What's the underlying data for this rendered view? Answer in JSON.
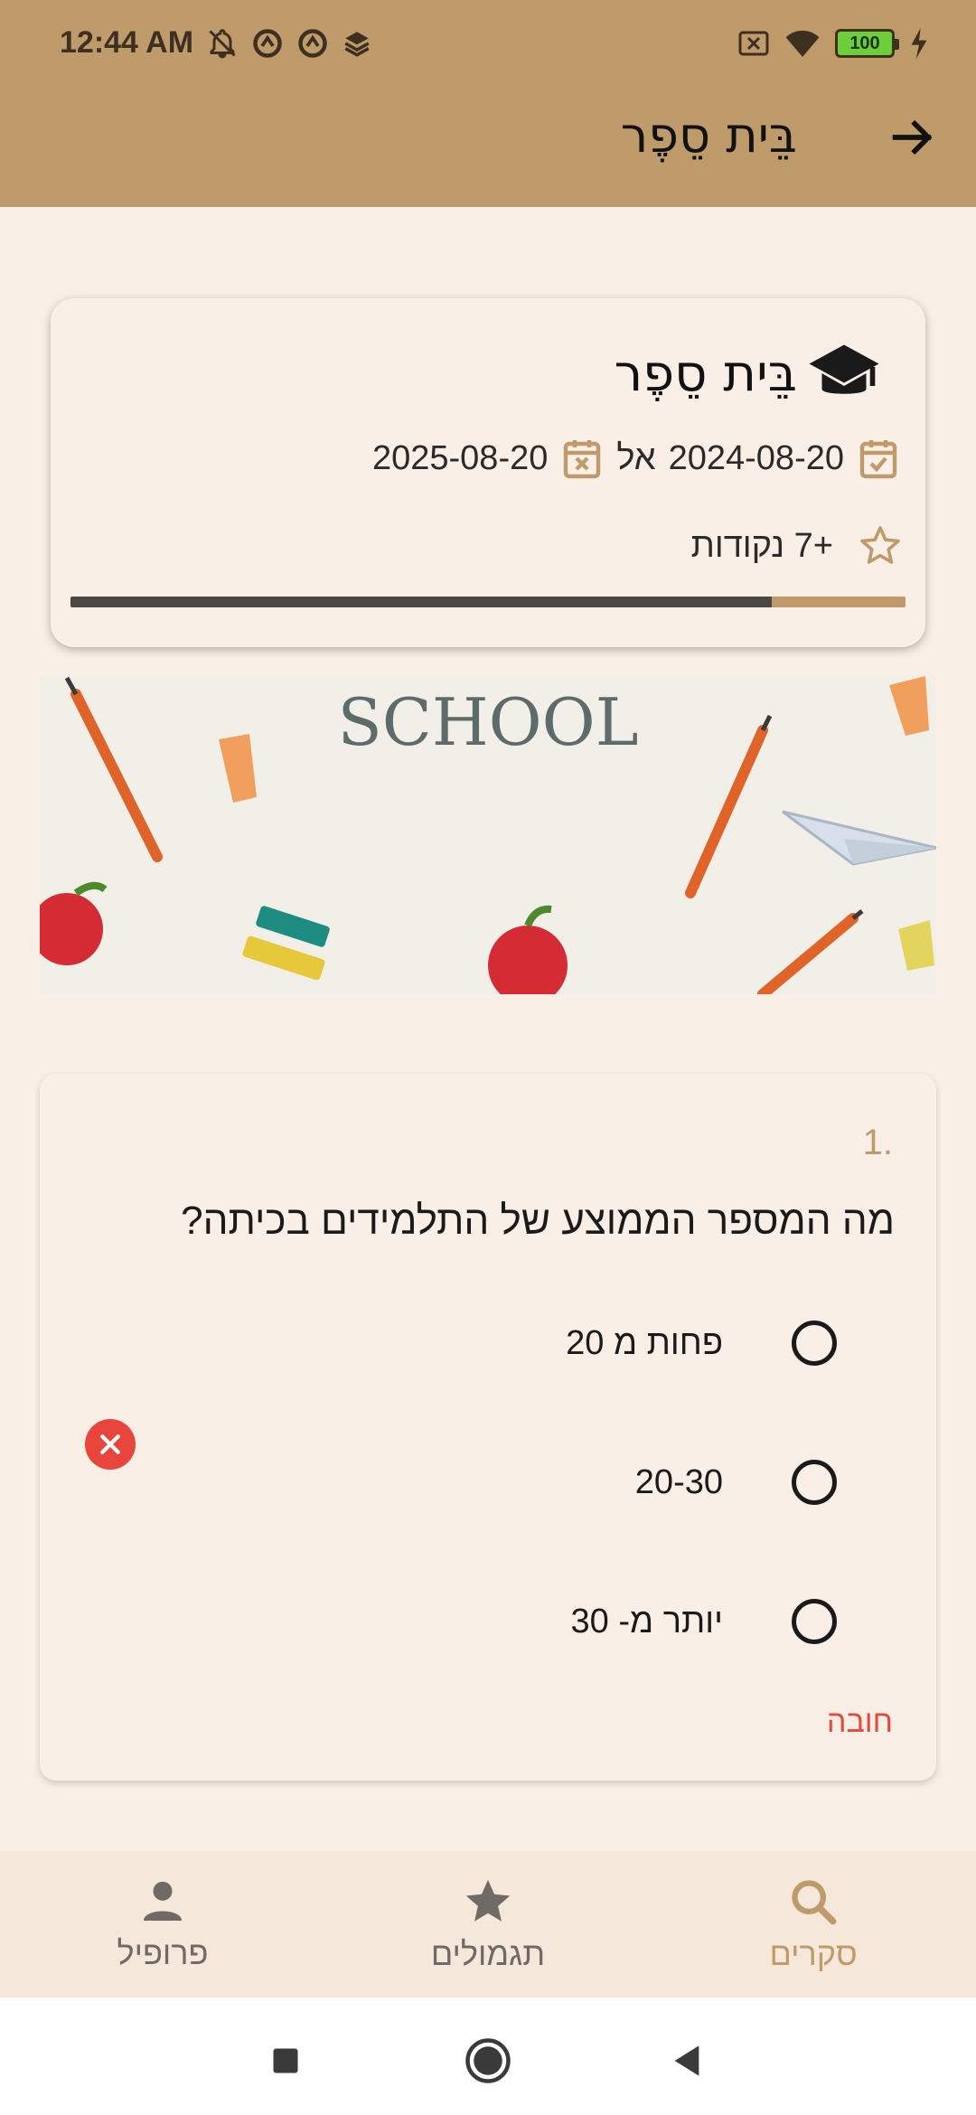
{
  "status_bar": {
    "time": "12:44 AM",
    "battery": "100"
  },
  "header": {
    "title": "בֵּית סֵפֶר"
  },
  "survey_card": {
    "title": "בֵּית סֵפֶר",
    "start_date": "2024-08-20",
    "date_separator": "אל",
    "end_date": "2025-08-20",
    "points": "+7 נקודות",
    "progress_fraction": 0.84
  },
  "banner": {
    "text": "SCHOOL"
  },
  "question": {
    "number": "1.",
    "text": "מה המספר הממוצע של התלמידים בכיתה?",
    "options": [
      "פחות מ 20",
      "20-30",
      "יותר מ- 30"
    ],
    "required_label": "חובה"
  },
  "bottom_nav": {
    "items": [
      {
        "label": "סקרים",
        "icon": "search-icon",
        "active": true
      },
      {
        "label": "תגמולים",
        "icon": "star-icon",
        "active": false
      },
      {
        "label": "פרופיל",
        "icon": "person-icon",
        "active": false
      }
    ]
  },
  "colors": {
    "accent": "#BF9A6A",
    "background": "#FAEFE6",
    "error": "#E8453C"
  }
}
